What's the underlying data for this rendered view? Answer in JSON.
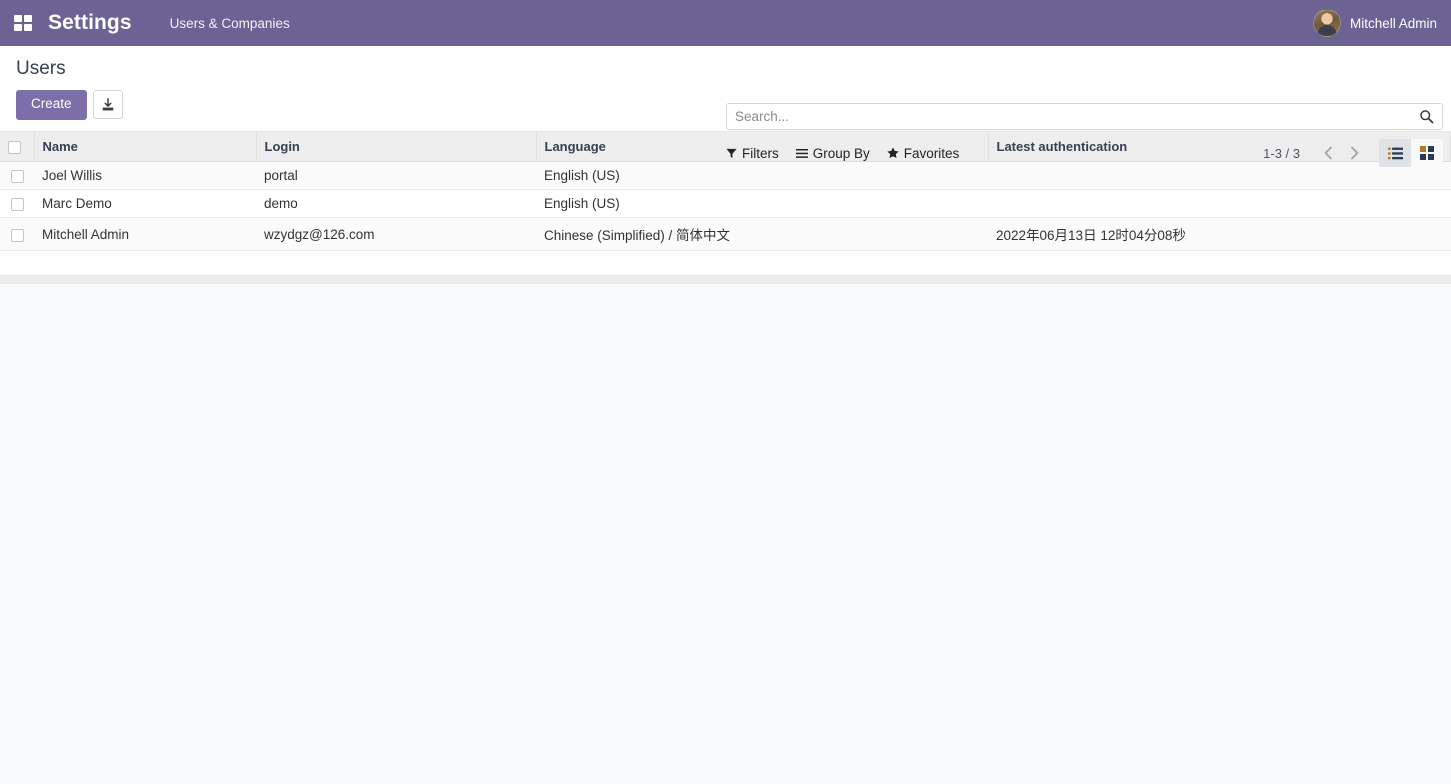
{
  "navbar": {
    "apps_icon": "apps-grid-icon",
    "brand": "Settings",
    "menu_item": "Users & Companies",
    "user_name": "Mitchell Admin",
    "bg_color": "#6c6294"
  },
  "control_panel": {
    "title": "Users",
    "create_label": "Create",
    "import_icon": "download-import-icon",
    "accent_color": "#7c6ea8"
  },
  "search": {
    "placeholder": "Search...",
    "value": "",
    "icon": "search-icon"
  },
  "filter_bar": {
    "filters_label": "Filters",
    "filters_icon": "funnel-icon",
    "groupby_label": "Group By",
    "groupby_icon": "hamburger-icon",
    "favorites_label": "Favorites",
    "favorites_icon": "star-icon"
  },
  "pager": {
    "range": "1-3 / 3",
    "prev_icon": "chevron-left-icon",
    "next_icon": "chevron-right-icon"
  },
  "view_switcher": {
    "list_icon": "list-view-icon",
    "kanban_icon": "kanban-view-icon",
    "active": "list"
  },
  "table": {
    "columns": [
      "Name",
      "Login",
      "Language",
      "Latest authentication"
    ],
    "rows": [
      {
        "name": "Joel Willis",
        "login": "portal",
        "language": "English (US)",
        "latest_authentication": ""
      },
      {
        "name": "Marc Demo",
        "login": "demo",
        "language": "English (US)",
        "latest_authentication": ""
      },
      {
        "name": "Mitchell Admin",
        "login": "wzydgz@126.com",
        "language": "Chinese (Simplified) / 简体中文",
        "latest_authentication": "2022年06月13日 12时04分08秒"
      }
    ]
  }
}
